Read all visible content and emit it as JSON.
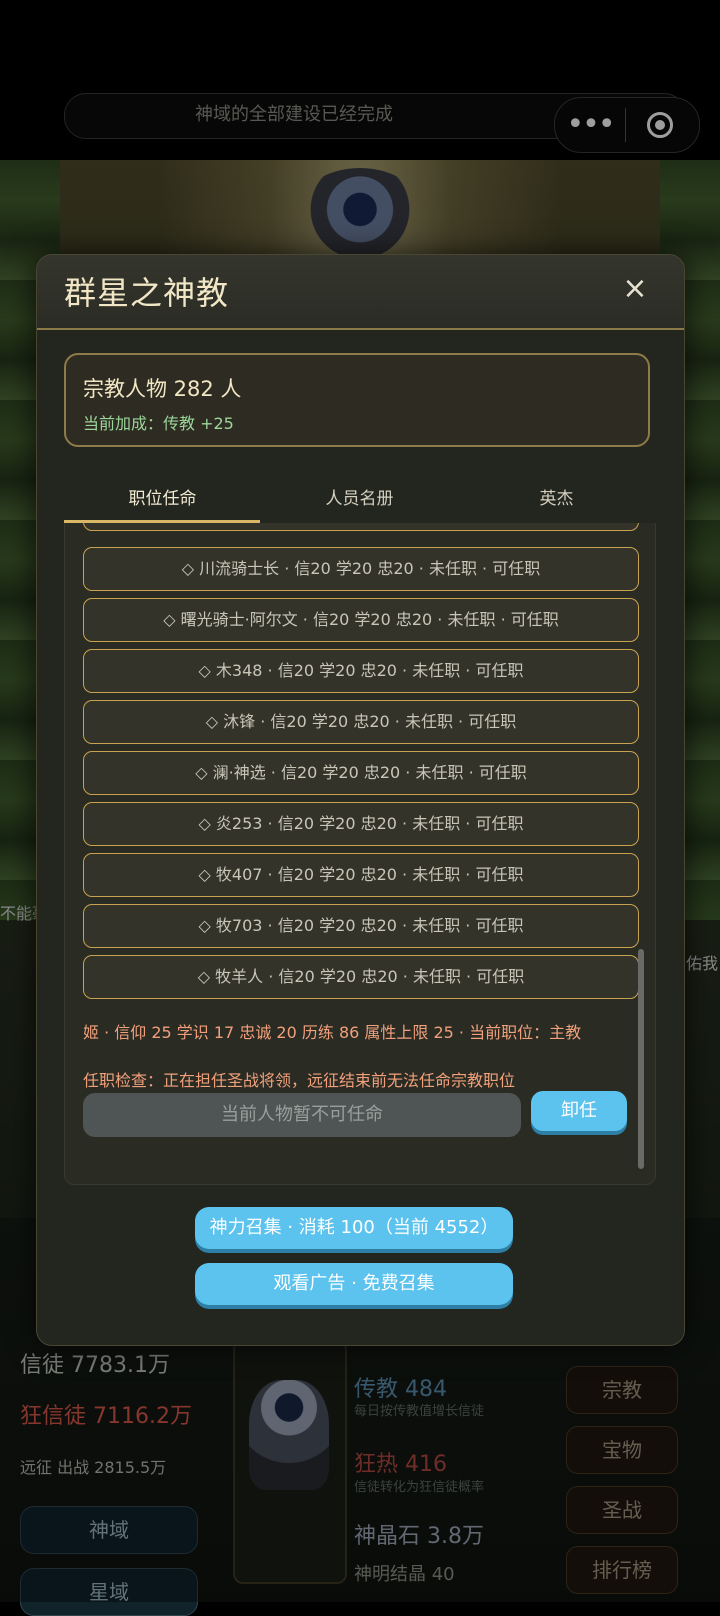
{
  "topbar": {
    "notice": "神域的全部建设已经完成",
    "more_glyph": "•••"
  },
  "background": {
    "left_peek": "不能毫",
    "right_peek": "佑我",
    "stats": {
      "believers": "信徒 7783.1万",
      "zealots": "狂信徒 7116.2万",
      "expedition": "远征 出战 2815.5万"
    },
    "left_buttons": [
      "神域",
      "星域"
    ],
    "middle": {
      "missionary": "传教 484",
      "missionary_desc": "每日按传教值增长信徒",
      "fervor": "狂热 416",
      "fervor_desc": "信徒转化为狂信徒概率",
      "crystal": "神晶石 3.8万",
      "divine_crystal": "神明结晶 40"
    },
    "right_buttons": [
      "宗教",
      "宝物",
      "圣战",
      "排行榜"
    ]
  },
  "modal": {
    "title": "群星之神教",
    "close_glyph": "×",
    "summary": {
      "count": "宗教人物 282 人",
      "bonus": "当前加成：传教 +25"
    },
    "tabs": [
      "职位任命",
      "人员名册",
      "英杰"
    ],
    "slots": [
      "◇ 川流骑士长 · 信20 学20 忠20 · 未任职 · 可任职",
      "◇ 曙光骑士·阿尔文 · 信20 学20 忠20 · 未任职 · 可任职",
      "◇ 木348 · 信20 学20 忠20 · 未任职 · 可任职",
      "◇ 沐锋 · 信20 学20 忠20 · 未任职 · 可任职",
      "◇ 澜·神选 · 信20 学20 忠20 · 未任职 · 可任职",
      "◇ 炎253 · 信20 学20 忠20 · 未任职 · 可任职",
      "◇ 牧407 · 信20 学20 忠20 · 未任职 · 可任职",
      "◇ 牧703 · 信20 学20 忠20 · 未任职 · 可任职",
      "◇ 牧羊人 · 信20 学20 忠20 · 未任职 · 可任职"
    ],
    "detail": {
      "stats": "姬 · 信仰 25 学识 17 忠诚 20 历练 86 属性上限 25 · 当前职位：主教",
      "check": "任职检查：正在担任圣战将领，远征结束前无法任命宗教职位"
    },
    "disabled_button": "当前人物暂不可任命",
    "unassign_button": "卸任",
    "summon_button": "神力召集 · 消耗 100（当前 4552）",
    "ad_button": "观看广告 · 免费召集"
  }
}
